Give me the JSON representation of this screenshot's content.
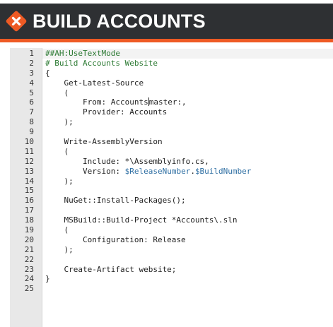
{
  "header": {
    "title": "BUILD ACCOUNTS",
    "logo_icon": "diamond-x-logo-icon",
    "colors": {
      "bar": "#2e3033",
      "accent": "#ee5a24",
      "logo": "#ee5a24"
    }
  },
  "editor": {
    "lines": [
      {
        "number": "1",
        "tokens": [
          {
            "t": "##AH:UseTextMode",
            "k": "comment"
          }
        ]
      },
      {
        "number": "2",
        "tokens": [
          {
            "t": "# Build Accounts Website",
            "k": "comment"
          }
        ]
      },
      {
        "number": "3",
        "tokens": [
          {
            "t": "{",
            "k": "plain"
          }
        ]
      },
      {
        "number": "4",
        "tokens": [
          {
            "t": "    Get-Latest-Source",
            "k": "plain"
          }
        ]
      },
      {
        "number": "5",
        "tokens": [
          {
            "t": "    (",
            "k": "plain"
          }
        ]
      },
      {
        "number": "6",
        "tokens": [
          {
            "t": "        From: Accounts",
            "k": "plain"
          },
          {
            "t": "",
            "k": "cursor"
          },
          {
            "t": "master:,",
            "k": "plain"
          }
        ]
      },
      {
        "number": "7",
        "tokens": [
          {
            "t": "        Provider: Accounts",
            "k": "plain"
          }
        ]
      },
      {
        "number": "8",
        "tokens": [
          {
            "t": "    );",
            "k": "plain"
          }
        ]
      },
      {
        "number": "9",
        "tokens": []
      },
      {
        "number": "10",
        "tokens": [
          {
            "t": "    Write-AssemblyVersion",
            "k": "plain"
          }
        ]
      },
      {
        "number": "11",
        "tokens": [
          {
            "t": "    (",
            "k": "plain"
          }
        ]
      },
      {
        "number": "12",
        "tokens": [
          {
            "t": "        Include: *\\Assemblyinfo.cs,",
            "k": "plain"
          }
        ]
      },
      {
        "number": "13",
        "tokens": [
          {
            "t": "        Version: ",
            "k": "plain"
          },
          {
            "t": "$ReleaseNumber",
            "k": "var"
          },
          {
            "t": ".",
            "k": "plain"
          },
          {
            "t": "$BuildNumber",
            "k": "var"
          }
        ]
      },
      {
        "number": "14",
        "tokens": [
          {
            "t": "    );",
            "k": "plain"
          }
        ]
      },
      {
        "number": "15",
        "tokens": []
      },
      {
        "number": "16",
        "tokens": [
          {
            "t": "    NuGet::Install-Packages();",
            "k": "plain"
          }
        ]
      },
      {
        "number": "17",
        "tokens": []
      },
      {
        "number": "18",
        "tokens": [
          {
            "t": "    MSBuild::Build-Project *Accounts\\.sln",
            "k": "plain"
          }
        ]
      },
      {
        "number": "19",
        "tokens": [
          {
            "t": "    (",
            "k": "plain"
          }
        ]
      },
      {
        "number": "20",
        "tokens": [
          {
            "t": "        Configuration: Release",
            "k": "plain"
          }
        ]
      },
      {
        "number": "21",
        "tokens": [
          {
            "t": "    );",
            "k": "plain"
          }
        ]
      },
      {
        "number": "22",
        "tokens": []
      },
      {
        "number": "23",
        "tokens": [
          {
            "t": "    Create-Artifact website;",
            "k": "plain"
          }
        ]
      },
      {
        "number": "24",
        "tokens": [
          {
            "t": "}",
            "k": "plain"
          }
        ]
      },
      {
        "number": "25",
        "tokens": []
      }
    ]
  }
}
